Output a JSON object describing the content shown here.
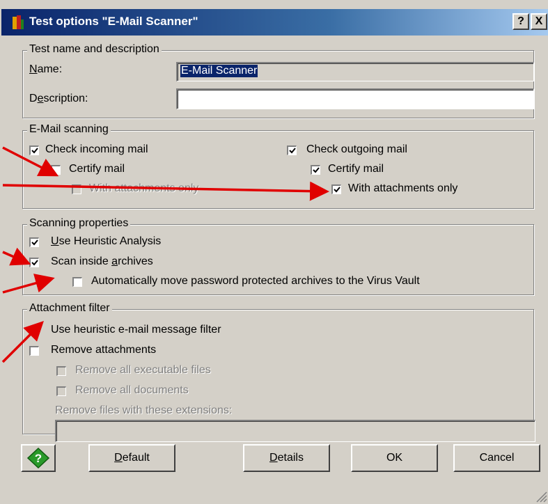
{
  "window": {
    "title": "Test options \"E-Mail Scanner\"",
    "help_label": "?",
    "close_label": "X"
  },
  "name_group": {
    "legend": "Test name and description",
    "name_label_u": "N",
    "name_label_rest": "ame:",
    "name_value": "E-Mail Scanner",
    "desc_label_pre": "D",
    "desc_label_u": "e",
    "desc_label_rest": "scription:",
    "desc_value": ""
  },
  "email_group": {
    "legend": "E-Mail scanning",
    "check_incoming": {
      "label": "Check incoming mail",
      "checked": true
    },
    "certify_in": {
      "label": "Certify mail",
      "checked": false
    },
    "attach_in": {
      "label": "With attachments only",
      "checked": false,
      "enabled": false
    },
    "check_outgoing": {
      "label": "Check outgoing mail",
      "checked": true
    },
    "certify_out": {
      "label": "Certify mail",
      "checked": true
    },
    "attach_out": {
      "label": "With attachments only",
      "checked": true
    }
  },
  "props_group": {
    "legend": "Scanning properties",
    "heuristic_u": "U",
    "heuristic_rest": "se Heuristic Analysis",
    "heuristic_checked": true,
    "archives_pre": "Scan inside ",
    "archives_u": "a",
    "archives_rest": "rchives",
    "archives_checked": true,
    "move_label": "Automatically move password protected archives to the Virus Vault",
    "move_checked": false
  },
  "attach_group": {
    "legend": "Attachment filter",
    "heur_filter": {
      "label": "Use heuristic e-mail message filter",
      "checked": true
    },
    "remove_attach": {
      "label": "Remove attachments",
      "checked": false
    },
    "remove_exec": {
      "label": "Remove all executable files",
      "checked": false,
      "enabled": false
    },
    "remove_docs": {
      "label": "Remove all documents",
      "checked": false,
      "enabled": false
    },
    "ext_label": "Remove files with these extensions:",
    "ext_value": ""
  },
  "buttons": {
    "default_u": "D",
    "default_rest": "efault",
    "details_u": "D",
    "details_rest": "etails",
    "ok": "OK",
    "cancel": "Cancel"
  },
  "colors": {
    "title_start": "#0a246a",
    "title_end": "#a6caf0",
    "face": "#d4d0c8",
    "arrow": "#e00000",
    "help_icon": "#2a9a2a"
  }
}
